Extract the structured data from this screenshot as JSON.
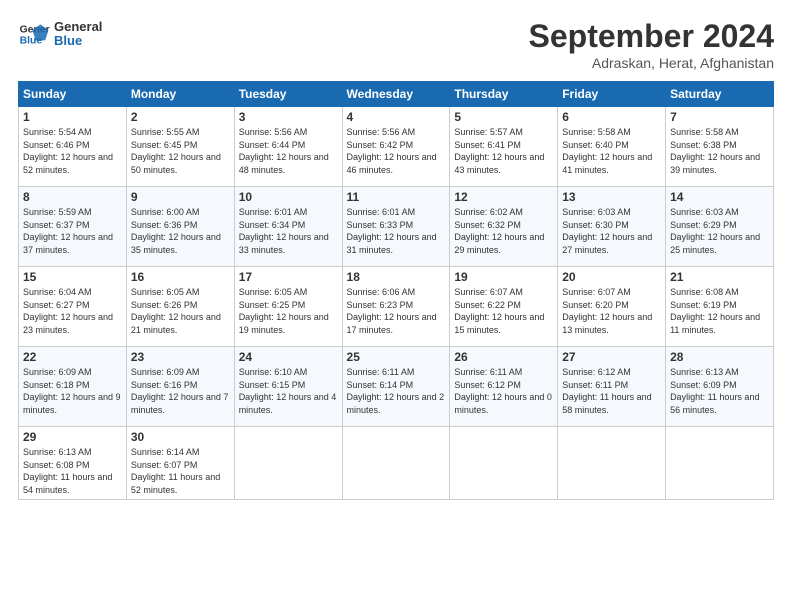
{
  "header": {
    "logo_line1": "General",
    "logo_line2": "Blue",
    "month_title": "September 2024",
    "subtitle": "Adraskan, Herat, Afghanistan"
  },
  "weekdays": [
    "Sunday",
    "Monday",
    "Tuesday",
    "Wednesday",
    "Thursday",
    "Friday",
    "Saturday"
  ],
  "weeks": [
    [
      {
        "day": "1",
        "sunrise": "5:54 AM",
        "sunset": "6:46 PM",
        "daylight": "12 hours and 52 minutes."
      },
      {
        "day": "2",
        "sunrise": "5:55 AM",
        "sunset": "6:45 PM",
        "daylight": "12 hours and 50 minutes."
      },
      {
        "day": "3",
        "sunrise": "5:56 AM",
        "sunset": "6:44 PM",
        "daylight": "12 hours and 48 minutes."
      },
      {
        "day": "4",
        "sunrise": "5:56 AM",
        "sunset": "6:42 PM",
        "daylight": "12 hours and 46 minutes."
      },
      {
        "day": "5",
        "sunrise": "5:57 AM",
        "sunset": "6:41 PM",
        "daylight": "12 hours and 43 minutes."
      },
      {
        "day": "6",
        "sunrise": "5:58 AM",
        "sunset": "6:40 PM",
        "daylight": "12 hours and 41 minutes."
      },
      {
        "day": "7",
        "sunrise": "5:58 AM",
        "sunset": "6:38 PM",
        "daylight": "12 hours and 39 minutes."
      }
    ],
    [
      {
        "day": "8",
        "sunrise": "5:59 AM",
        "sunset": "6:37 PM",
        "daylight": "12 hours and 37 minutes."
      },
      {
        "day": "9",
        "sunrise": "6:00 AM",
        "sunset": "6:36 PM",
        "daylight": "12 hours and 35 minutes."
      },
      {
        "day": "10",
        "sunrise": "6:01 AM",
        "sunset": "6:34 PM",
        "daylight": "12 hours and 33 minutes."
      },
      {
        "day": "11",
        "sunrise": "6:01 AM",
        "sunset": "6:33 PM",
        "daylight": "12 hours and 31 minutes."
      },
      {
        "day": "12",
        "sunrise": "6:02 AM",
        "sunset": "6:32 PM",
        "daylight": "12 hours and 29 minutes."
      },
      {
        "day": "13",
        "sunrise": "6:03 AM",
        "sunset": "6:30 PM",
        "daylight": "12 hours and 27 minutes."
      },
      {
        "day": "14",
        "sunrise": "6:03 AM",
        "sunset": "6:29 PM",
        "daylight": "12 hours and 25 minutes."
      }
    ],
    [
      {
        "day": "15",
        "sunrise": "6:04 AM",
        "sunset": "6:27 PM",
        "daylight": "12 hours and 23 minutes."
      },
      {
        "day": "16",
        "sunrise": "6:05 AM",
        "sunset": "6:26 PM",
        "daylight": "12 hours and 21 minutes."
      },
      {
        "day": "17",
        "sunrise": "6:05 AM",
        "sunset": "6:25 PM",
        "daylight": "12 hours and 19 minutes."
      },
      {
        "day": "18",
        "sunrise": "6:06 AM",
        "sunset": "6:23 PM",
        "daylight": "12 hours and 17 minutes."
      },
      {
        "day": "19",
        "sunrise": "6:07 AM",
        "sunset": "6:22 PM",
        "daylight": "12 hours and 15 minutes."
      },
      {
        "day": "20",
        "sunrise": "6:07 AM",
        "sunset": "6:20 PM",
        "daylight": "12 hours and 13 minutes."
      },
      {
        "day": "21",
        "sunrise": "6:08 AM",
        "sunset": "6:19 PM",
        "daylight": "12 hours and 11 minutes."
      }
    ],
    [
      {
        "day": "22",
        "sunrise": "6:09 AM",
        "sunset": "6:18 PM",
        "daylight": "12 hours and 9 minutes."
      },
      {
        "day": "23",
        "sunrise": "6:09 AM",
        "sunset": "6:16 PM",
        "daylight": "12 hours and 7 minutes."
      },
      {
        "day": "24",
        "sunrise": "6:10 AM",
        "sunset": "6:15 PM",
        "daylight": "12 hours and 4 minutes."
      },
      {
        "day": "25",
        "sunrise": "6:11 AM",
        "sunset": "6:14 PM",
        "daylight": "12 hours and 2 minutes."
      },
      {
        "day": "26",
        "sunrise": "6:11 AM",
        "sunset": "6:12 PM",
        "daylight": "12 hours and 0 minutes."
      },
      {
        "day": "27",
        "sunrise": "6:12 AM",
        "sunset": "6:11 PM",
        "daylight": "11 hours and 58 minutes."
      },
      {
        "day": "28",
        "sunrise": "6:13 AM",
        "sunset": "6:09 PM",
        "daylight": "11 hours and 56 minutes."
      }
    ],
    [
      {
        "day": "29",
        "sunrise": "6:13 AM",
        "sunset": "6:08 PM",
        "daylight": "11 hours and 54 minutes."
      },
      {
        "day": "30",
        "sunrise": "6:14 AM",
        "sunset": "6:07 PM",
        "daylight": "11 hours and 52 minutes."
      },
      null,
      null,
      null,
      null,
      null
    ]
  ]
}
